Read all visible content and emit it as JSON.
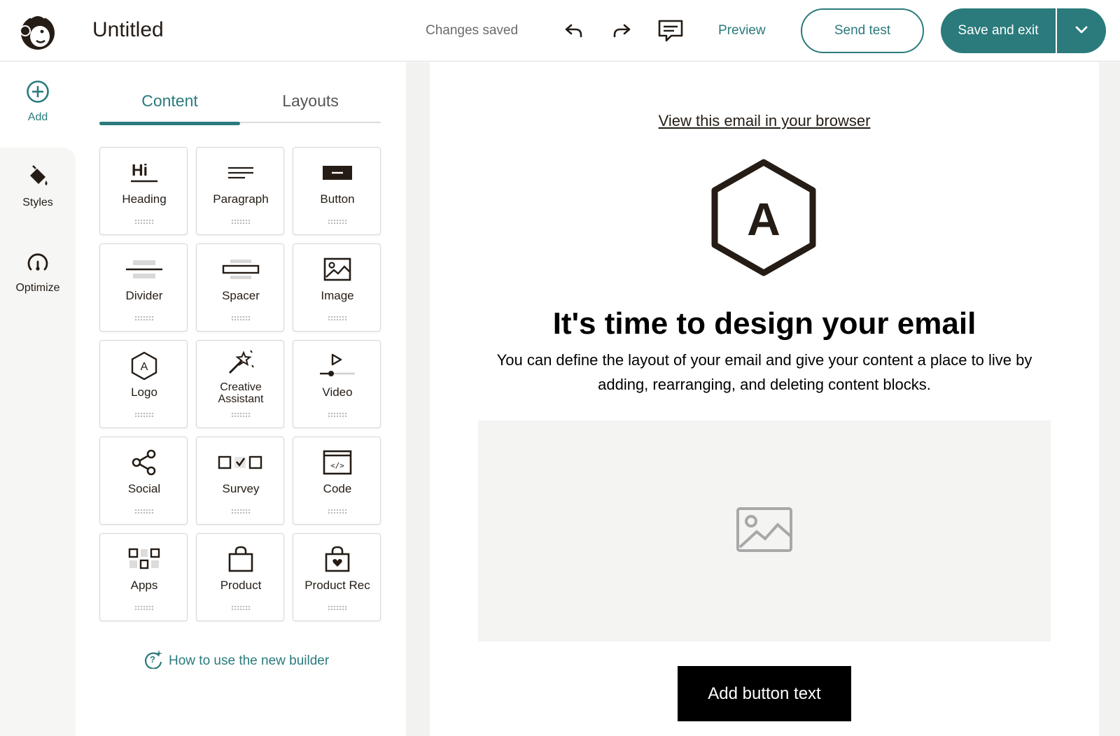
{
  "header": {
    "title": "Untitled",
    "status": "Changes saved",
    "preview_label": "Preview",
    "send_test_label": "Send test",
    "save_exit_label": "Save and exit"
  },
  "rail": {
    "items": [
      {
        "label": "Add",
        "icon": "plus-circle-icon"
      },
      {
        "label": "Styles",
        "icon": "paint-bucket-icon"
      },
      {
        "label": "Optimize",
        "icon": "gauge-icon"
      }
    ]
  },
  "panel": {
    "tabs": [
      {
        "label": "Content"
      },
      {
        "label": "Layouts"
      }
    ],
    "blocks": [
      {
        "label": "Heading",
        "icon": "heading-icon"
      },
      {
        "label": "Paragraph",
        "icon": "paragraph-icon"
      },
      {
        "label": "Button",
        "icon": "button-icon"
      },
      {
        "label": "Divider",
        "icon": "divider-icon"
      },
      {
        "label": "Spacer",
        "icon": "spacer-icon"
      },
      {
        "label": "Image",
        "icon": "image-icon"
      },
      {
        "label": "Logo",
        "icon": "logo-icon",
        "glyph": "A"
      },
      {
        "label_line1": "Creative",
        "label_line2": "Assistant",
        "icon": "magic-wand-icon"
      },
      {
        "label": "Video",
        "icon": "video-icon"
      },
      {
        "label": "Social",
        "icon": "share-icon"
      },
      {
        "label": "Survey",
        "icon": "survey-icon"
      },
      {
        "label": "Code",
        "icon": "code-icon",
        "glyph": "</>"
      },
      {
        "label": "Apps",
        "icon": "apps-icon"
      },
      {
        "label": "Product",
        "icon": "shopping-bag-icon"
      },
      {
        "label": "Product Rec",
        "icon": "product-rec-icon"
      }
    ],
    "help_link": "How to use the new builder",
    "heading_glyph": "Hi"
  },
  "email": {
    "view_in_browser": "View this email in your browser",
    "logo_letter": "A",
    "headline": "It's time to design your email",
    "body": "You can define the layout of your email and give your content a place to live by adding, rearranging, and deleting content blocks.",
    "button_text": "Add button text"
  },
  "colors": {
    "accent": "#2b7a7c",
    "text": "#241c15",
    "muted": "#6b6b6b"
  }
}
